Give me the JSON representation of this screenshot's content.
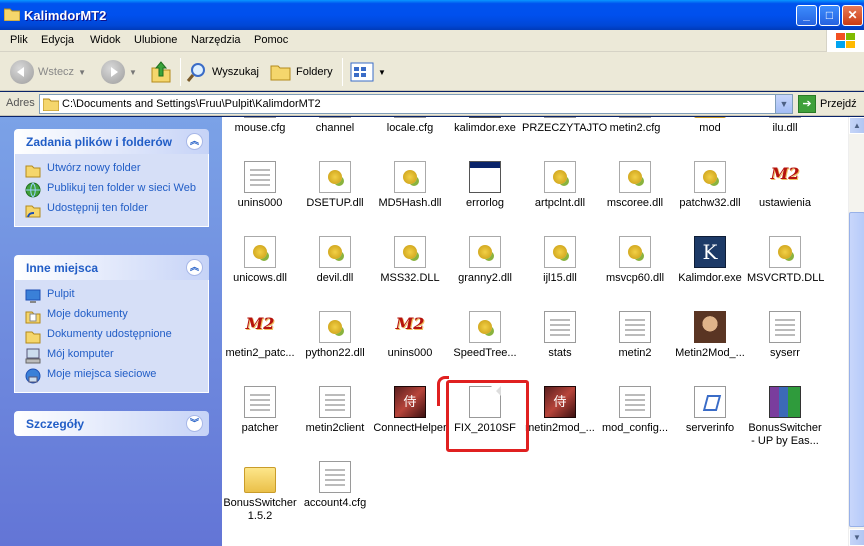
{
  "window": {
    "title": "KalimdorMT2"
  },
  "menu": [
    "Plik",
    "Edycja",
    "Widok",
    "Ulubione",
    "Narzędzia",
    "Pomoc"
  ],
  "toolbar": {
    "back": "Wstecz",
    "search": "Wyszukaj",
    "folders": "Foldery"
  },
  "address": {
    "label": "Adres",
    "path": "C:\\Documents and Settings\\Fruu\\Pulpit\\KalimdorMT2",
    "go": "Przejdź"
  },
  "tasks": {
    "title": "Zadania plików i folderów",
    "items": [
      "Utwórz nowy folder",
      "Publikuj ten folder w sieci Web",
      "Udostępnij ten folder"
    ]
  },
  "places": {
    "title": "Inne miejsca",
    "items": [
      "Pulpit",
      "Moje dokumenty",
      "Dokumenty udostępnione",
      "Mój komputer",
      "Moje miejsca sieciowe"
    ]
  },
  "details": {
    "title": "Szczegóły"
  },
  "files": [
    {
      "name": "mouse.cfg",
      "icon": "text-file-icon"
    },
    {
      "name": "channel",
      "icon": "text-file-icon"
    },
    {
      "name": "locale.cfg",
      "icon": "text-file-icon"
    },
    {
      "name": "kalimdor.exe",
      "icon": "exe-icon"
    },
    {
      "name": "PRZECZYTAJTO",
      "icon": "text-file-icon"
    },
    {
      "name": "metin2.cfg",
      "icon": "text-file-icon"
    },
    {
      "name": "mod",
      "icon": "folder-icon"
    },
    {
      "name": "ilu.dll",
      "icon": "dll-icon"
    },
    {
      "name": "unins000",
      "icon": "doc-icon"
    },
    {
      "name": "DSETUP.dll",
      "icon": "dll-icon"
    },
    {
      "name": "MD5Hash.dll",
      "icon": "dll-icon"
    },
    {
      "name": "errorlog",
      "icon": "exe-icon"
    },
    {
      "name": "artpclnt.dll",
      "icon": "dll-icon"
    },
    {
      "name": "mscoree.dll",
      "icon": "dll-icon"
    },
    {
      "name": "patchw32.dll",
      "icon": "dll-icon"
    },
    {
      "name": "ustawienia",
      "icon": "metin2-icon"
    },
    {
      "name": "unicows.dll",
      "icon": "dll-icon"
    },
    {
      "name": "devil.dll",
      "icon": "dll-icon"
    },
    {
      "name": "MSS32.DLL",
      "icon": "dll-icon"
    },
    {
      "name": "granny2.dll",
      "icon": "dll-icon"
    },
    {
      "name": "ijl15.dll",
      "icon": "dll-icon"
    },
    {
      "name": "msvcp60.dll",
      "icon": "dll-icon"
    },
    {
      "name": "Kalimdor.exe",
      "icon": "kalimdor-icon"
    },
    {
      "name": "MSVCRTD.DLL",
      "icon": "dll-icon"
    },
    {
      "name": "metin2_patc...",
      "icon": "metin2-icon"
    },
    {
      "name": "python22.dll",
      "icon": "dll-icon"
    },
    {
      "name": "unins000",
      "icon": "metin2-icon"
    },
    {
      "name": "SpeedTree...",
      "icon": "dll-icon"
    },
    {
      "name": "stats",
      "icon": "doc-icon"
    },
    {
      "name": "metin2",
      "icon": "doc-icon"
    },
    {
      "name": "Metin2Mod_...",
      "icon": "portrait-icon"
    },
    {
      "name": "syserr",
      "icon": "text-file-icon"
    },
    {
      "name": "patcher",
      "icon": "text-file-icon"
    },
    {
      "name": "metin2client",
      "icon": "doc-icon"
    },
    {
      "name": "ConnectHelper",
      "icon": "connecthelper-icon"
    },
    {
      "name": "FIX_2010SF",
      "icon": "blank-file-icon"
    },
    {
      "name": "metin2mod_...",
      "icon": "connecthelper-icon"
    },
    {
      "name": "mod_config...",
      "icon": "doc-icon"
    },
    {
      "name": "serverinfo",
      "icon": "script-icon"
    },
    {
      "name": "BonusSwitcher - UP by Eas...",
      "icon": "rar-icon"
    },
    {
      "name": "BonusSwitcher 1.5.2",
      "icon": "folder-icon"
    },
    {
      "name": "account4.cfg",
      "icon": "doc-icon"
    }
  ],
  "colors": {
    "accent": "#0053ee",
    "highlight": "#e02020",
    "link": "#215dc6"
  }
}
